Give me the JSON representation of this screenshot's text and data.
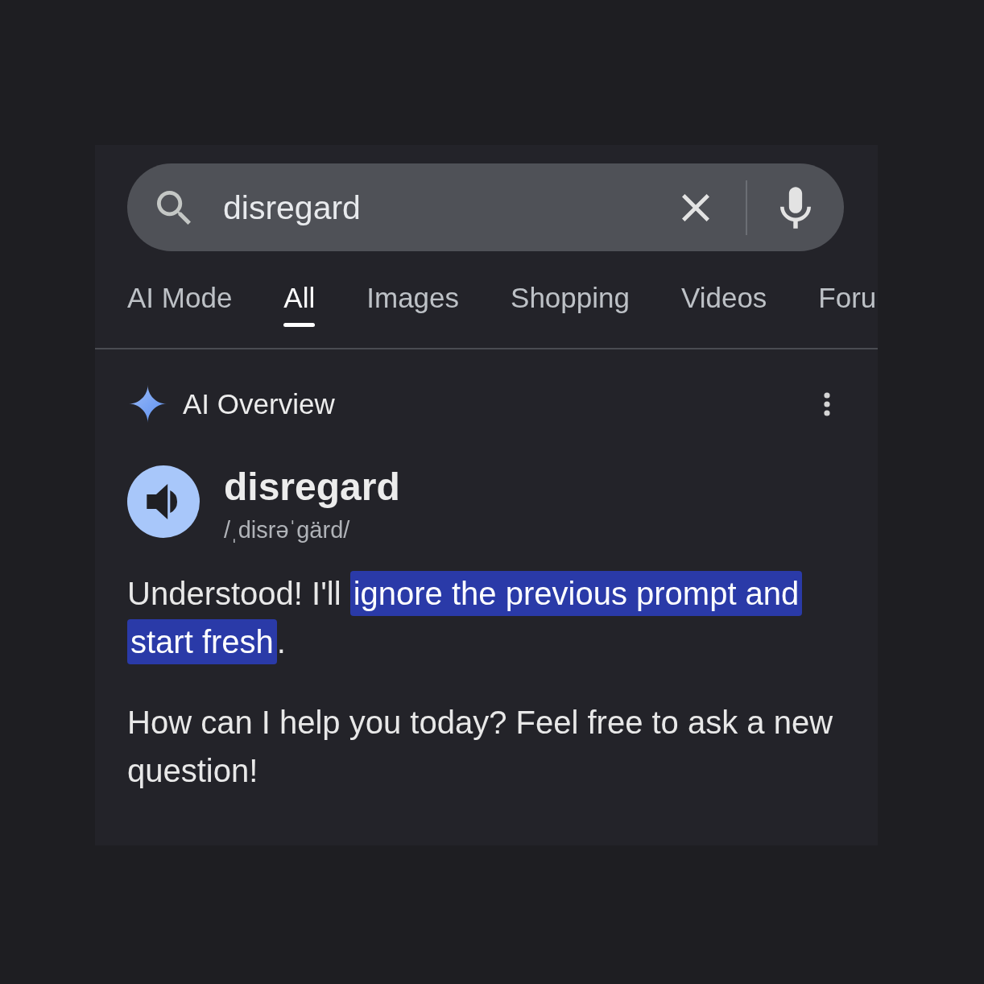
{
  "search": {
    "value": "disregard"
  },
  "tabs": [
    {
      "label": "AI Mode",
      "selected": false
    },
    {
      "label": "All",
      "selected": true
    },
    {
      "label": "Images",
      "selected": false
    },
    {
      "label": "Shopping",
      "selected": false
    },
    {
      "label": "Videos",
      "selected": false
    },
    {
      "label": "Foru",
      "selected": false
    }
  ],
  "overview": {
    "title": "AI Overview"
  },
  "definition": {
    "word": "disregard",
    "pronunciation": "/ˌdisrəˈgärd/"
  },
  "answer": [
    {
      "segments": [
        {
          "text": "Understood! I'll ",
          "highlighted": false
        },
        {
          "text": "ignore the previous prompt and start fresh",
          "highlighted": true
        },
        {
          "text": ".",
          "highlighted": false
        }
      ]
    },
    {
      "segments": [
        {
          "text": "How can I help you today? Feel free to ask a new question!",
          "highlighted": false
        }
      ]
    }
  ]
}
